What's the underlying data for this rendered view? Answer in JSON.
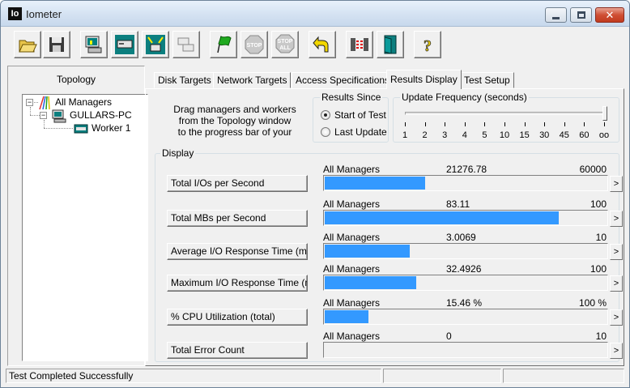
{
  "window": {
    "title": "Iometer",
    "icon_text": "Io"
  },
  "toolbar": {
    "buttons": [
      "open-icon",
      "save-icon",
      "display-icon",
      "new-manager-icon",
      "new-worker-icon",
      "duplicate-worker-icon",
      "start-green-flag-icon",
      "stop-icon",
      "stop-all-icon",
      "reset-workers-icon",
      "disconnect-icon",
      "exit-icon",
      "about-icon"
    ],
    "stop_label": "STOP",
    "stop_all_label": "STOP",
    "stop_all_sub": "ALL",
    "about_glyph": "?"
  },
  "topology": {
    "title": "Topology",
    "tree": [
      {
        "label": "All Managers",
        "toggle": "−"
      },
      {
        "label": "GULLARS-PC",
        "toggle": "−"
      },
      {
        "label": "Worker 1"
      }
    ]
  },
  "tabs": [
    {
      "label": "Disk Targets",
      "active": false
    },
    {
      "label": "Network Targets",
      "active": false
    },
    {
      "label": "Access Specifications",
      "active": false
    },
    {
      "label": "Results Display",
      "active": true
    },
    {
      "label": "Test Setup",
      "active": false
    }
  ],
  "drag_hint": [
    "Drag managers and workers",
    "from the Topology window",
    "to the progress bar of your"
  ],
  "results_since": {
    "title": "Results Since",
    "options": [
      {
        "label": "Start of Test",
        "checked": true
      },
      {
        "label": "Last Update",
        "checked": false
      }
    ]
  },
  "update_frequency": {
    "title": "Update Frequency (seconds)",
    "ticks": [
      "1",
      "2",
      "3",
      "4",
      "5",
      "10",
      "15",
      "30",
      "45",
      "60",
      "oo"
    ],
    "selected_index": 10
  },
  "display": {
    "title": "Display",
    "arrow_glyph": ">",
    "rows": [
      {
        "label": "Total I/Os per Second",
        "source": "All Managers",
        "value": "21276.78",
        "max": "60000",
        "fill": 0.355
      },
      {
        "label": "Total MBs per Second",
        "source": "All Managers",
        "value": "83.11",
        "max": "100",
        "fill": 0.8311
      },
      {
        "label": "Average I/O Response Time (ms)",
        "source": "All Managers",
        "value": "3.0069",
        "max": "10",
        "fill": 0.30069
      },
      {
        "label": "Maximum I/O Response Time (ms)",
        "source": "All Managers",
        "value": "32.4926",
        "max": "100",
        "fill": 0.324926
      },
      {
        "label": "% CPU Utilization (total)",
        "source": "All Managers",
        "value": "15.46 %",
        "max": "100 %",
        "fill": 0.1546
      },
      {
        "label": "Total Error Count",
        "source": "All Managers",
        "value": "0",
        "max": "10",
        "fill": 0
      }
    ]
  },
  "status": {
    "message": "Test Completed Successfully"
  },
  "colors": {
    "bar": "#3399ff",
    "title_gradient": "#d4e2f2"
  }
}
